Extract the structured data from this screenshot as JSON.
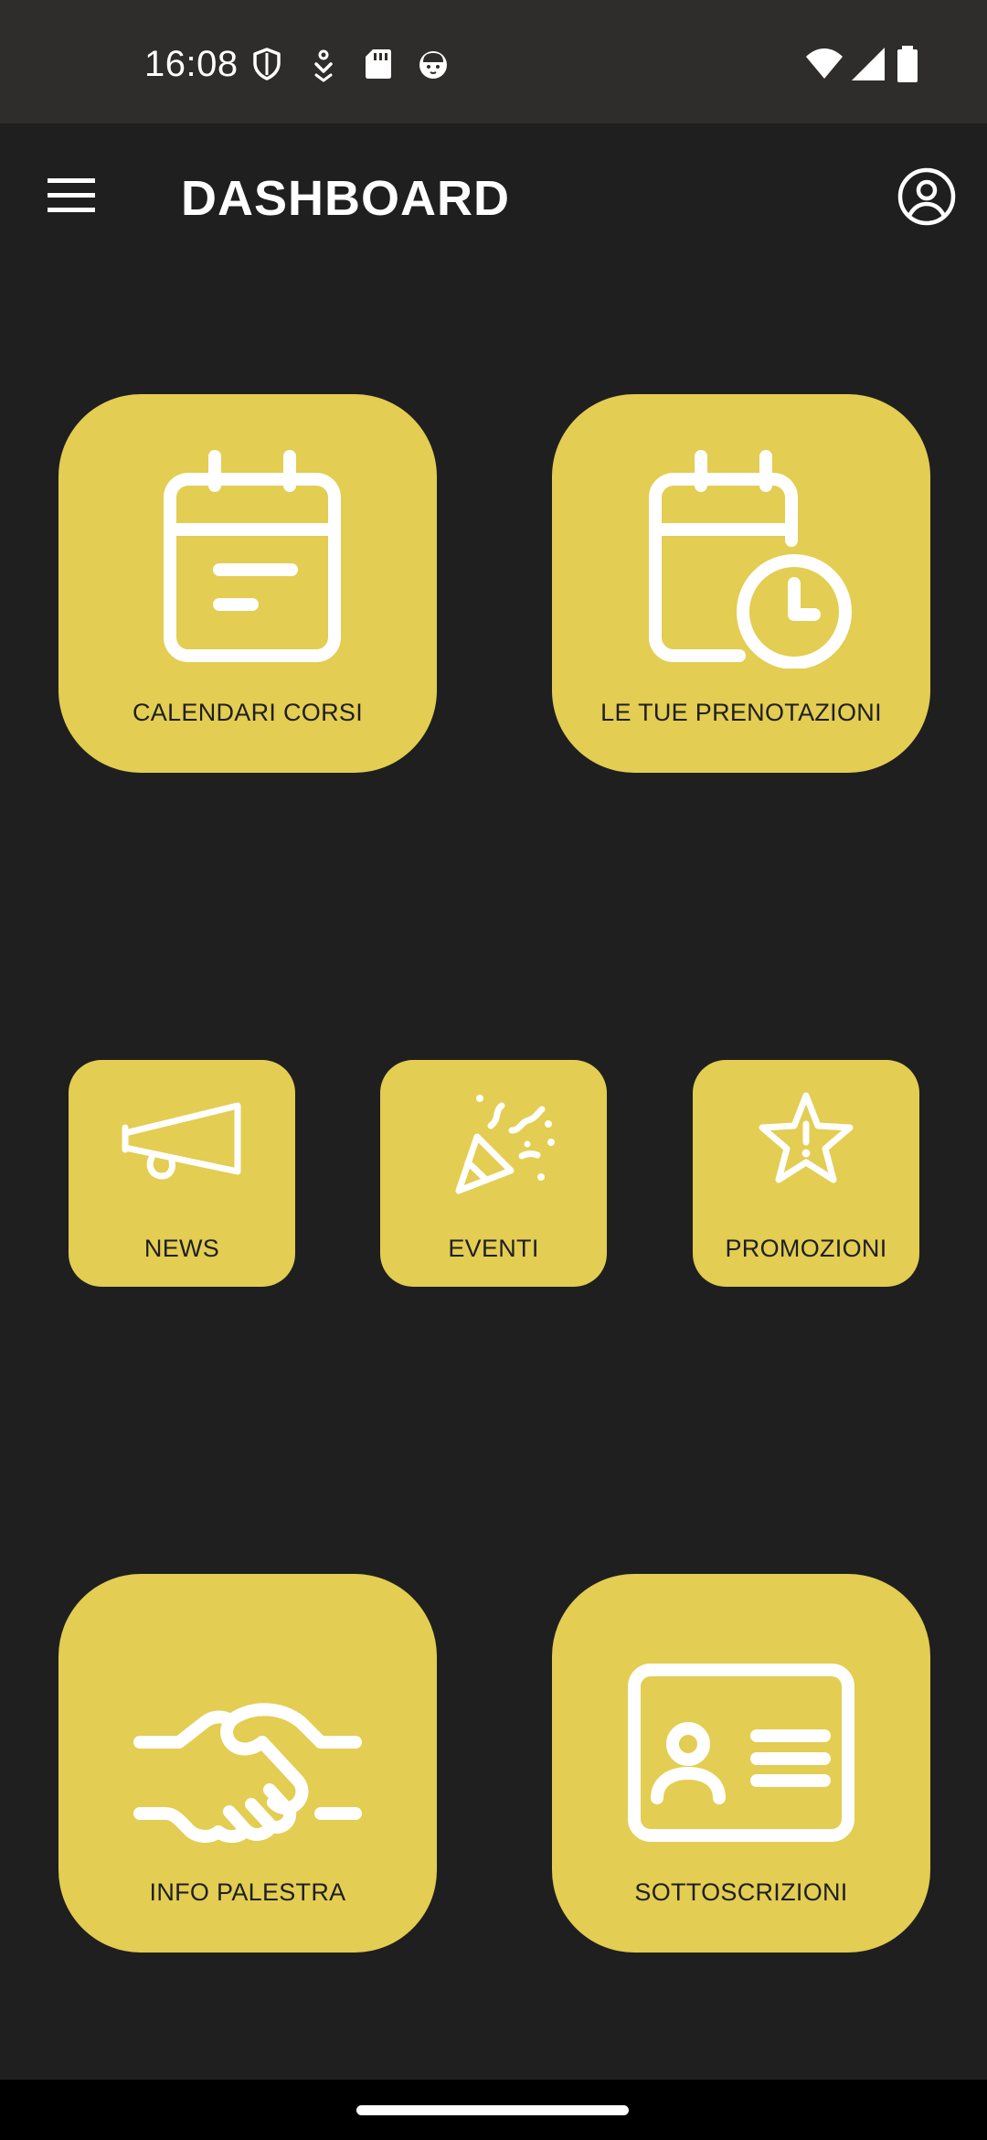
{
  "status_bar": {
    "time": "16:08",
    "icons_left": [
      "shield-icon",
      "download-icon",
      "sd-card-icon",
      "cat-face-icon"
    ],
    "icons_right": [
      "wifi-icon",
      "signal-icon",
      "battery-icon"
    ]
  },
  "app_bar": {
    "title": "DASHBOARD",
    "menu_icon": "hamburger-menu-icon",
    "profile_icon": "account-circle-icon"
  },
  "tiles": [
    {
      "label": "CALENDARI CORSI",
      "icon": "calendar-icon"
    },
    {
      "label": "LE TUE PRENOTAZIONI",
      "icon": "calendar-clock-icon"
    },
    {
      "label": "NEWS",
      "icon": "megaphone-icon"
    },
    {
      "label": "EVENTI",
      "icon": "party-popper-icon"
    },
    {
      "label": "PROMOZIONI",
      "icon": "star-alert-icon"
    },
    {
      "label": "INFO PALESTRA",
      "icon": "handshake-icon"
    },
    {
      "label": "SOTTOSCRIZIONI",
      "icon": "id-card-icon"
    }
  ],
  "colors": {
    "background": "#1f1f1f",
    "status_bar": "#2f2d2b",
    "tile": "#e3cd52",
    "tile_text": "#1f1f1f",
    "icon_stroke": "#ffffff"
  }
}
